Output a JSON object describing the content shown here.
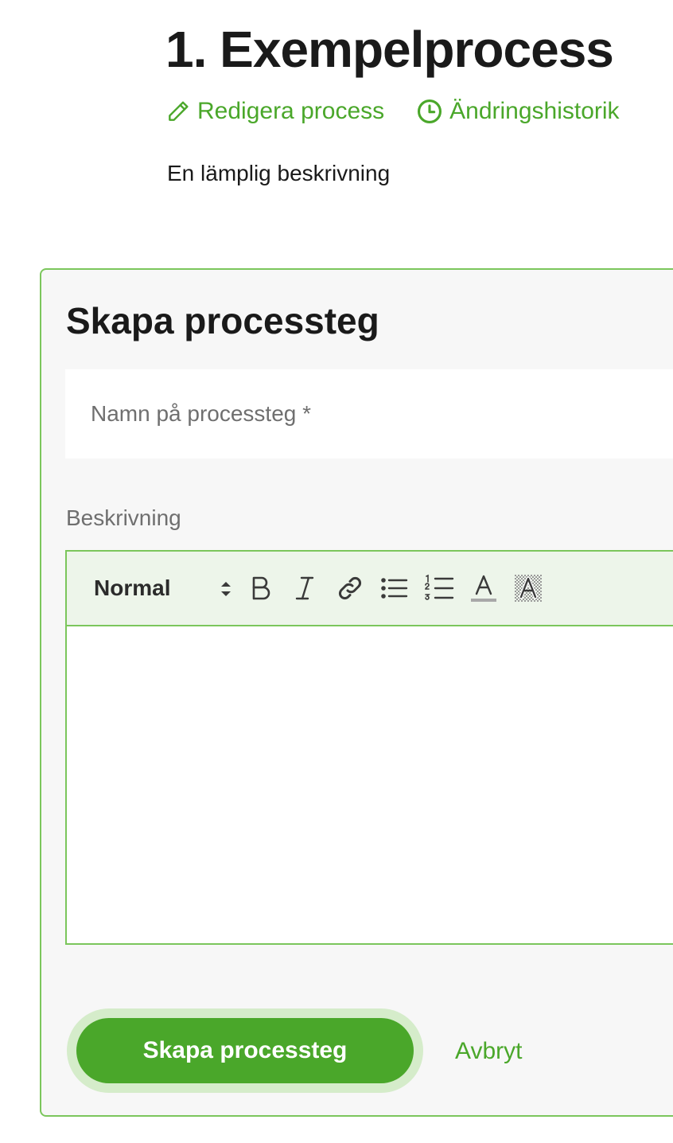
{
  "header": {
    "title": "1. Exempelprocess",
    "description": "En lämplig beskrivning"
  },
  "actions": {
    "edit_label": "Redigera process",
    "history_label": "Ändringshistorik"
  },
  "form": {
    "title": "Skapa processteg",
    "name_placeholder": "Namn på processteg *",
    "name_value": "",
    "description_label": "Beskrivning",
    "editor": {
      "format_value": "Normal",
      "tools": [
        "bold-icon",
        "italic-icon",
        "link-icon",
        "bullet-list-icon",
        "numbered-list-icon",
        "text-color-icon",
        "highlight-color-icon"
      ],
      "content": ""
    },
    "submit_label": "Skapa processteg",
    "cancel_label": "Avbryt"
  },
  "colors": {
    "accent": "#4aa72a",
    "accent_light": "#d5ecca",
    "toolbar_bg": "#edf5ea",
    "border": "#7bc65c",
    "panel_bg": "#f7f7f7"
  }
}
